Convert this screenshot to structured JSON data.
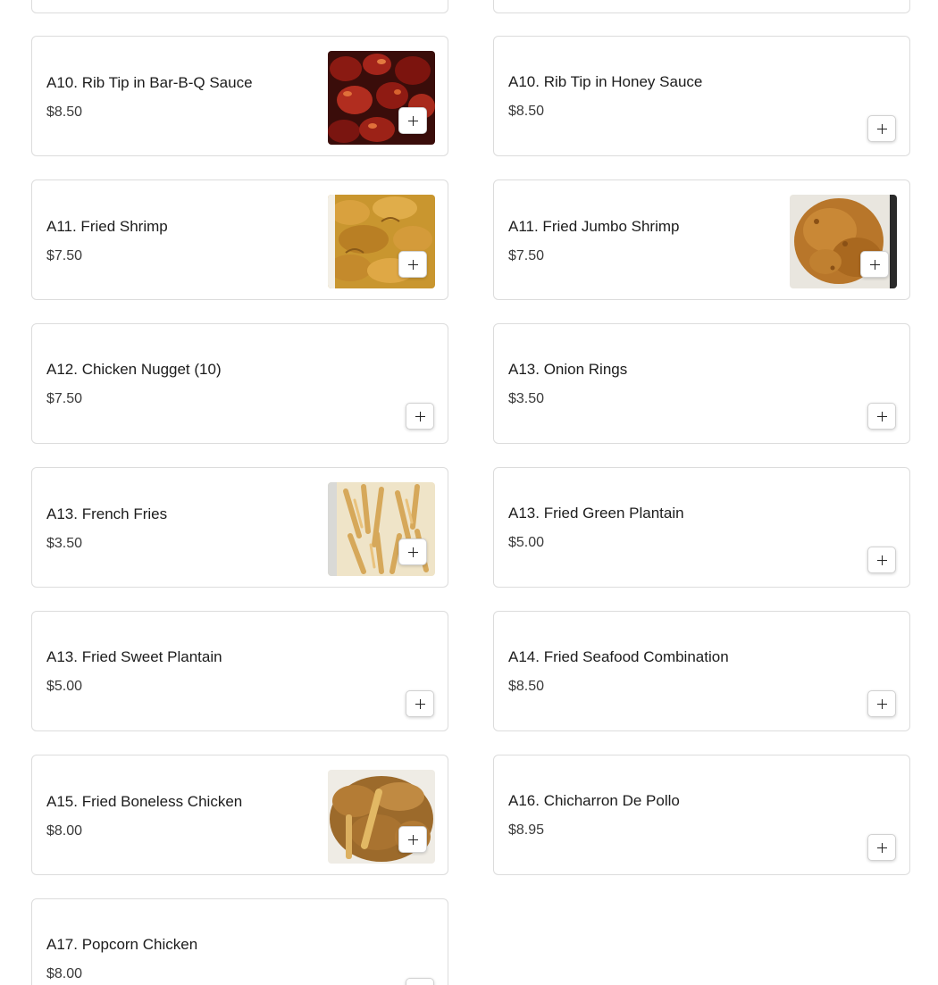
{
  "menu_items": [
    {
      "name": "A10. Rib Tip in Bar-B-Q Sauce",
      "price": "$8.50",
      "image": "rib-tip-bbq-photo"
    },
    {
      "name": "A10. Rib Tip in Honey Sauce",
      "price": "$8.50"
    },
    {
      "name": "A11. Fried Shrimp",
      "price": "$7.50",
      "image": "fried-shrimp-photo"
    },
    {
      "name": "A11. Fried Jumbo Shrimp",
      "price": "$7.50",
      "image": "fried-jumbo-shrimp-photo"
    },
    {
      "name": "A12. Chicken Nugget (10)",
      "price": "$7.50"
    },
    {
      "name": "A13. Onion Rings",
      "price": "$3.50"
    },
    {
      "name": "A13. French Fries",
      "price": "$3.50",
      "image": "french-fries-photo"
    },
    {
      "name": "A13. Fried Green Plantain",
      "price": "$5.00"
    },
    {
      "name": "A13. Fried Sweet Plantain",
      "price": "$5.00"
    },
    {
      "name": "A14. Fried Seafood Combination",
      "price": "$8.50"
    },
    {
      "name": "A15. Fried Boneless Chicken",
      "price": "$8.00",
      "image": "fried-boneless-chicken-photo"
    },
    {
      "name": "A16. Chicharron De Pollo",
      "price": "$8.95"
    },
    {
      "name": "A17. Popcorn Chicken",
      "price": "$8.00"
    }
  ],
  "add_icon": "plus-icon"
}
